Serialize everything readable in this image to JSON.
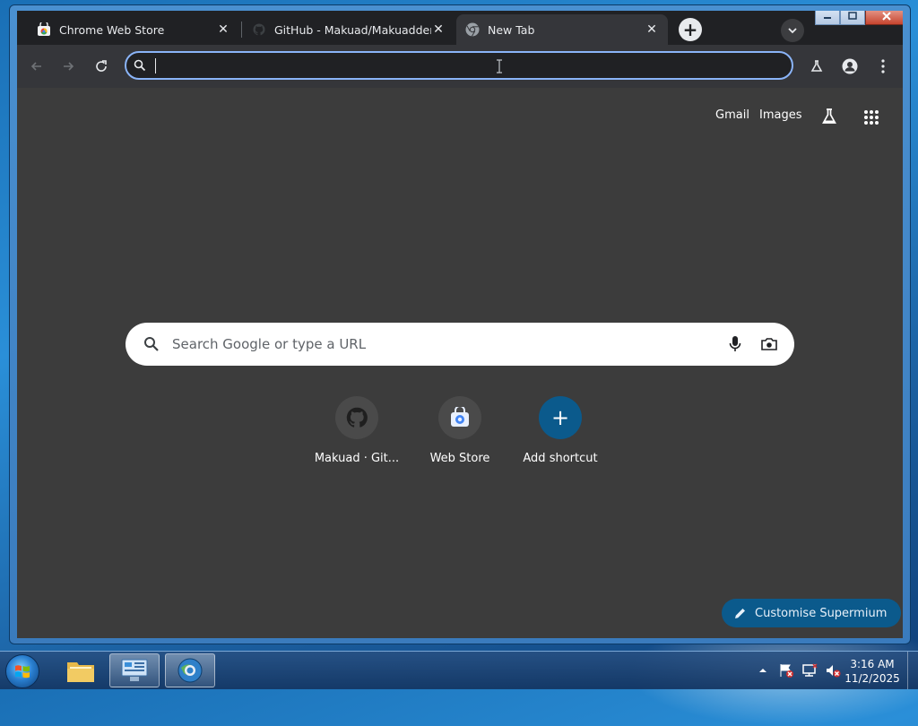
{
  "tabs": [
    {
      "title": "Chrome Web Store",
      "favicon": "chrome-web-store-icon",
      "close": "✕"
    },
    {
      "title": "GitHub - Makuad/Makuadderly",
      "favicon": "github-icon",
      "close": "✕"
    },
    {
      "title": "New Tab",
      "favicon": "chrome-icon",
      "close": "✕",
      "active": true
    }
  ],
  "new_tab_label": "+",
  "omnibox": {
    "value": "",
    "placeholder": ""
  },
  "top_links": {
    "gmail": "Gmail",
    "images": "Images"
  },
  "search": {
    "placeholder": "Search Google or type a URL"
  },
  "shortcuts": [
    {
      "label": "Makuad · Git...",
      "icon": "github-icon"
    },
    {
      "label": "Web Store",
      "icon": "web-store-icon"
    },
    {
      "label": "Add shortcut",
      "icon": "plus-icon"
    }
  ],
  "add_symbol": "+",
  "customise": {
    "label": "Customise Supermium"
  },
  "clock": {
    "time": "3:16 AM",
    "date": "11/2/2025"
  },
  "colors": {
    "accent": "#8ab4f8",
    "button": "#0b5a8c",
    "page_bg": "#3c3c3c"
  }
}
